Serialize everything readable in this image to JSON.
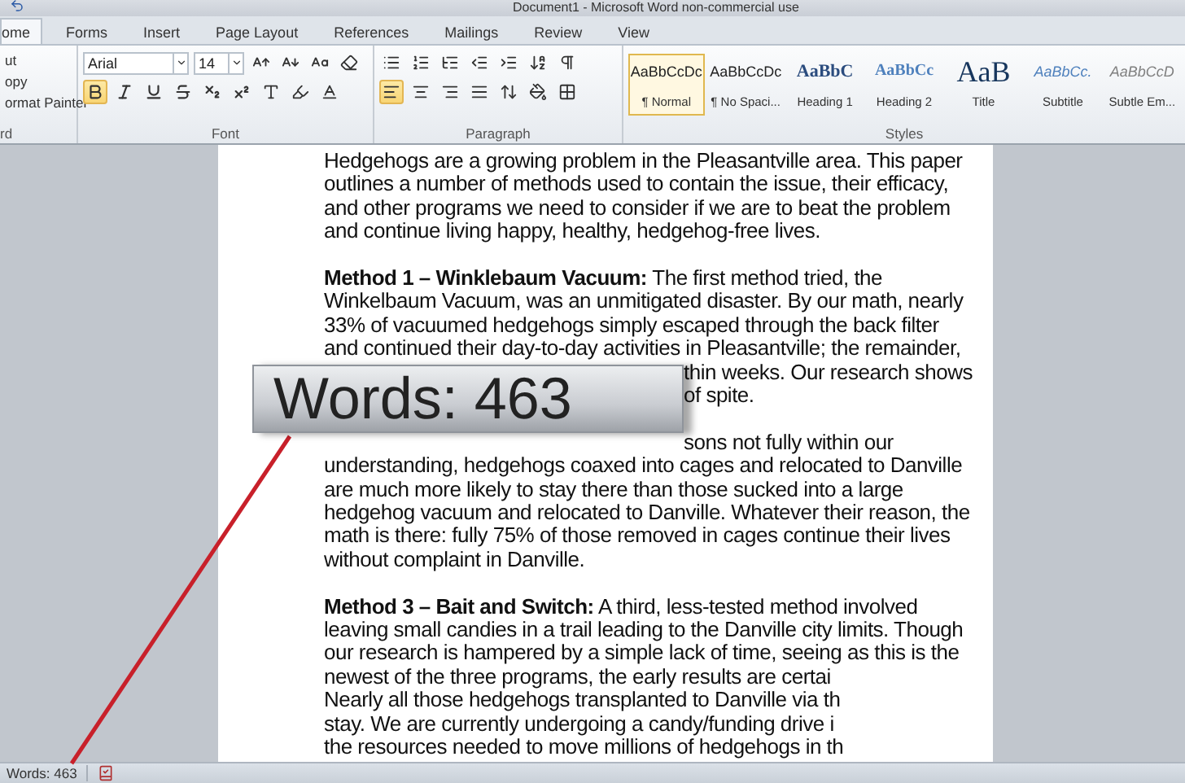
{
  "window": {
    "title": "Document1 - Microsoft Word non-commercial use"
  },
  "tabs": [
    {
      "label": "ome",
      "selected": true
    },
    {
      "label": "Forms",
      "selected": false
    },
    {
      "label": "Insert",
      "selected": false
    },
    {
      "label": "Page Layout",
      "selected": false
    },
    {
      "label": "References",
      "selected": false
    },
    {
      "label": "Mailings",
      "selected": false
    },
    {
      "label": "Review",
      "selected": false
    },
    {
      "label": "View",
      "selected": false
    }
  ],
  "ribbon": {
    "clipboard": {
      "items": [
        "ut",
        "opy",
        "ormat Painter"
      ],
      "label": "rd"
    },
    "font": {
      "name": "Arial",
      "size": "14",
      "label": "Font",
      "buttons": [
        {
          "kind": "bold",
          "selected": true
        },
        {
          "kind": "italic",
          "selected": false
        },
        {
          "kind": "underline",
          "selected": false
        },
        {
          "kind": "strike",
          "selected": false
        },
        {
          "kind": "subscript",
          "selected": false
        },
        {
          "kind": "superscript",
          "selected": false
        }
      ]
    },
    "paragraph": {
      "label": "Paragraph",
      "alignment": [
        {
          "kind": "left",
          "selected": true
        },
        {
          "kind": "center",
          "selected": false
        },
        {
          "kind": "right",
          "selected": false
        },
        {
          "kind": "justify",
          "selected": false
        }
      ]
    },
    "styles": {
      "label": "Styles",
      "items": [
        {
          "preview": "AaBbCcDc",
          "name": "¶ Normal",
          "kind": "body",
          "selected": true
        },
        {
          "preview": "AaBbCcDc",
          "name": "¶ No Spaci...",
          "kind": "body",
          "selected": false
        },
        {
          "preview": "AaBbC",
          "name": "Heading 1",
          "kind": "heading1",
          "selected": false
        },
        {
          "preview": "AaBbCc",
          "name": "Heading 2",
          "kind": "heading2",
          "selected": false
        },
        {
          "preview": "AaB",
          "name": "Title",
          "kind": "title",
          "selected": false
        },
        {
          "preview": "AaBbCc.",
          "name": "Subtitle",
          "kind": "subtitle",
          "selected": false
        },
        {
          "preview": "AaBbCcD",
          "name": "Subtle Em...",
          "kind": "emphasis",
          "selected": false
        }
      ]
    }
  },
  "document": {
    "paragraphs": [
      {
        "lines": [
          {
            "text": "Hedgehogs are a growing problem in the Pleasantville area. This paper",
            "kind": "full"
          },
          {
            "text": "outlines a number of methods used to contain the issue, their efficacy,",
            "kind": "full"
          },
          {
            "text": "and other programs we need to consider if we are to beat the problem",
            "kind": "full"
          },
          {
            "text": "and continue living happy, healthy, hedgehog-free lives.",
            "kind": "full"
          }
        ]
      },
      {
        "lines": [
          {
            "text": "**Method 1 – Winklebaum Vacuum:** The first method tried, the",
            "kind": "full"
          },
          {
            "text": "Winkelbaum Vacuum, was an unmitigated disaster. By our math, nearly",
            "kind": "full"
          },
          {
            "text": "33% of vacuumed hedgehogs simply escaped through the back filter",
            "kind": "full"
          },
          {
            "text": "and continued their day-to-day activities in Pleasantville; the remainder,",
            "kind": "full"
          },
          {
            "text": "thin weeks. Our research shows",
            "kind": "tail"
          },
          {
            "text": "of spite.",
            "kind": "tail"
          }
        ]
      },
      {
        "lines": [
          {
            "text": "sons not fully within our",
            "kind": "tail"
          },
          {
            "text": "understanding, hedgehogs coaxed into cages and relocated to Danville",
            "kind": "full"
          },
          {
            "text": "are much more likely to stay there than those sucked into a large",
            "kind": "full"
          },
          {
            "text": "hedgehog vacuum and relocated to Danville. Whatever their reason, the",
            "kind": "full"
          },
          {
            "text": "math is there: fully 75% of those removed in cages continue their lives",
            "kind": "full"
          },
          {
            "text": "without complaint in Danville.",
            "kind": "full"
          }
        ]
      },
      {
        "lines": [
          {
            "text": "**Method 3 – Bait and Switch:** A third, less-tested method involved",
            "kind": "full"
          },
          {
            "text": "leaving small candies in a trail leading to the Danville city limits. Though",
            "kind": "full"
          },
          {
            "text": "our research is hampered by a simple lack of time, seeing as this is the",
            "kind": "full"
          },
          {
            "text": "newest of the three programs, the early results are certai",
            "kind": "full"
          },
          {
            "text": "Nearly all those hedgehogs transplanted to Danville via th",
            "kind": "full"
          },
          {
            "text": "stay. We are currently undergoing a candy/funding drive i",
            "kind": "full"
          },
          {
            "text": "the resources needed to move millions of hedgehogs in th",
            "kind": "full"
          }
        ]
      }
    ]
  },
  "callout": {
    "text": "Words: 463"
  },
  "status_bar": {
    "word_count": "Words: 463"
  }
}
